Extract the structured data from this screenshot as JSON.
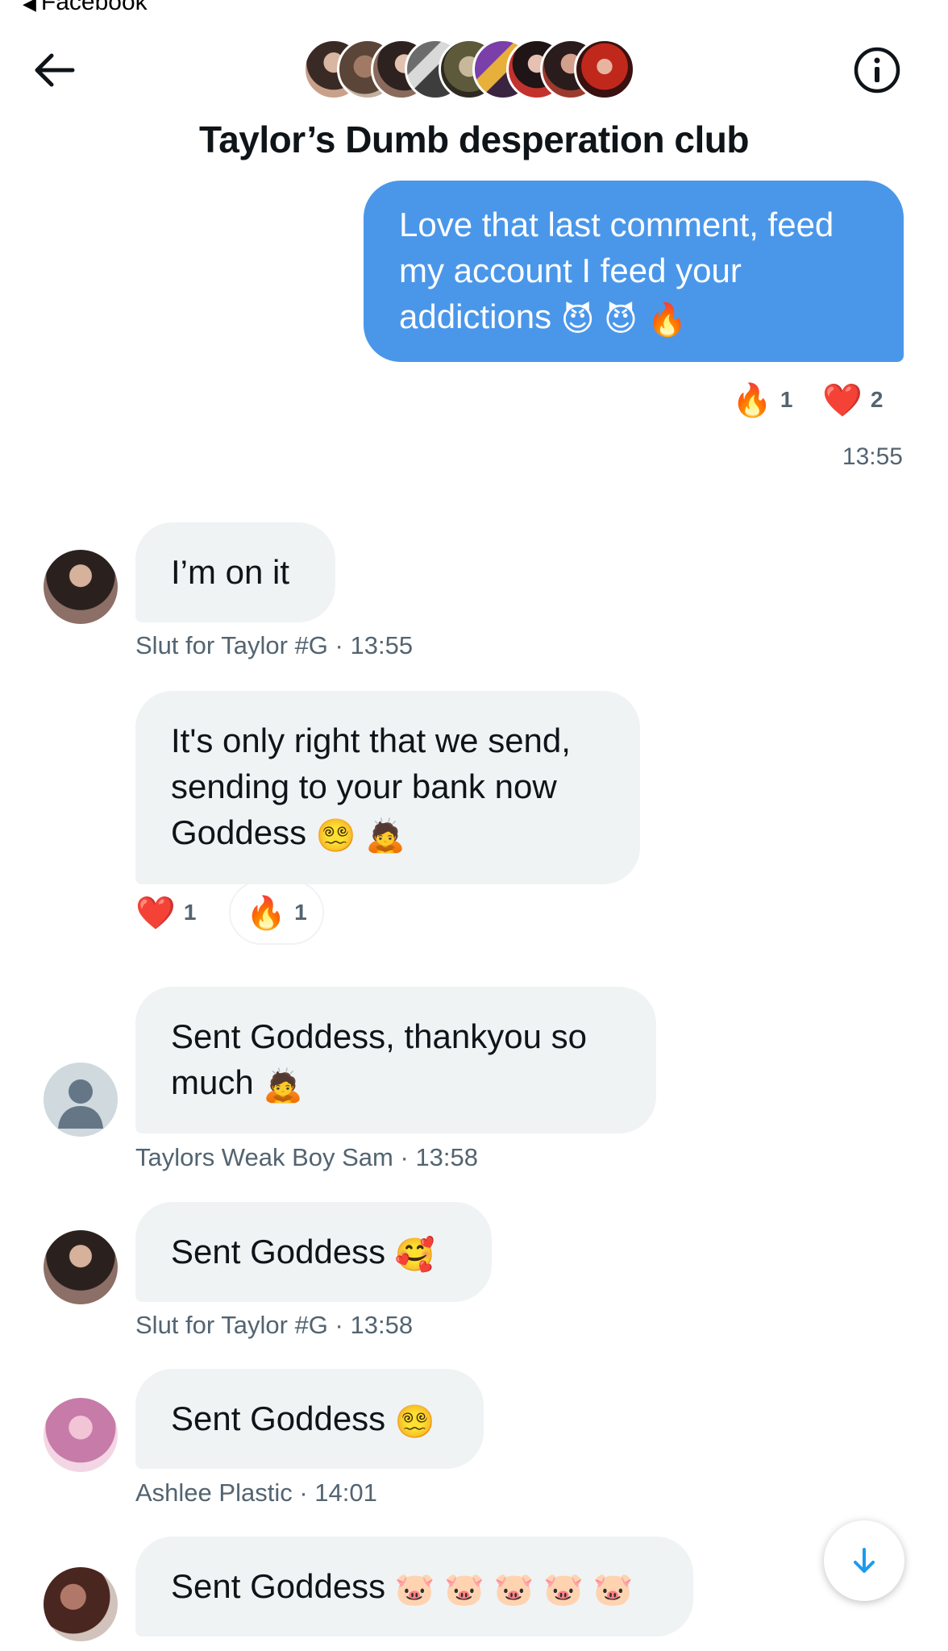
{
  "status_bar": {
    "back_app": "Facebook"
  },
  "header": {
    "title": "Taylor’s Dumb desperation club",
    "participant_avatar_count": 9
  },
  "messages": [
    {
      "direction": "outgoing",
      "text": "Love that last comment, feed my account I feed your addictions",
      "lines": [
        "Love that last comment, feed",
        "my account I feed your",
        "addictions"
      ],
      "emojis": [
        "😈",
        "😈",
        "🔥"
      ],
      "reactions": [
        {
          "emoji": "🔥",
          "count": "1"
        },
        {
          "emoji": "❤️",
          "count": "2"
        }
      ],
      "time": "13:55"
    },
    {
      "direction": "incoming",
      "text": "I’m on it",
      "sender": "Slut for Taylor #G",
      "time": "13:55"
    },
    {
      "direction": "incoming",
      "lines": [
        "It's only right that we send,",
        "sending to your bank now",
        "Goddess"
      ],
      "emojis": [
        "😵‍💫",
        "🙇"
      ],
      "reactions": [
        {
          "emoji": "❤️",
          "count": "1"
        },
        {
          "emoji": "🔥",
          "count": "1"
        }
      ]
    },
    {
      "direction": "incoming",
      "lines": [
        "Sent Goddess, thankyou so",
        "much"
      ],
      "emojis": [
        "🙇"
      ],
      "sender": "Taylors Weak Boy Sam",
      "time": "13:58"
    },
    {
      "direction": "incoming",
      "text": "Sent Goddess",
      "emojis": [
        "🥰"
      ],
      "sender": "Slut for Taylor #G",
      "time": "13:58"
    },
    {
      "direction": "incoming",
      "text": "Sent Goddess",
      "emojis": [
        "😵‍💫"
      ],
      "sender": "Ashlee Plastic",
      "time": "14:01"
    },
    {
      "direction": "incoming",
      "text": "Sent Goddess",
      "emojis": [
        "🐷",
        "🐷",
        "🐷",
        "🐷",
        "🐷"
      ]
    }
  ],
  "icons": {
    "back": "arrow-left-icon",
    "info": "info-circle-icon",
    "scroll_down": "arrow-down-icon",
    "default_avatar": "person-silhouette-icon"
  },
  "colors": {
    "outgoing_bubble": "#4a97ea",
    "incoming_bubble": "#eff3f4",
    "meta_text": "#536471",
    "accent": "#1d9bf0"
  }
}
